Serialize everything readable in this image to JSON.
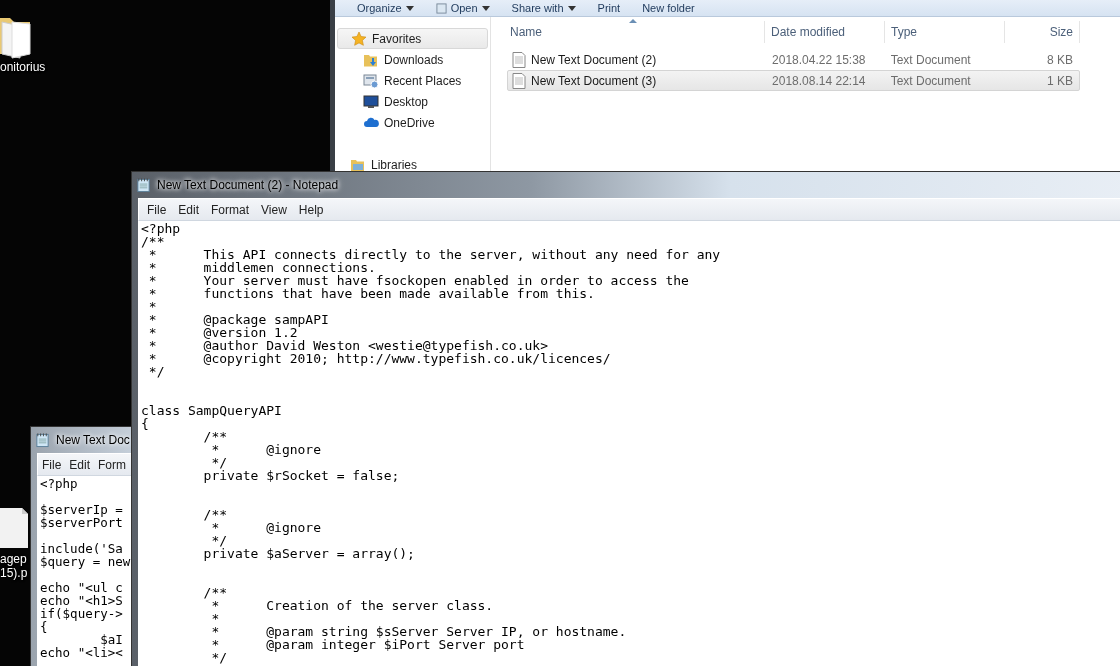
{
  "desktop_icons": [
    {
      "kind": "folder",
      "label_lines": [
        "onitorius"
      ]
    },
    {
      "kind": "file",
      "label_lines": [
        "agep",
        "15).p"
      ]
    }
  ],
  "explorer": {
    "toolbar": [
      {
        "label": "Organize",
        "dropdown": true,
        "kind": "plain"
      },
      {
        "label": "Open",
        "dropdown": true,
        "kind": "document"
      },
      {
        "label": "Share with",
        "dropdown": true,
        "kind": "plain"
      },
      {
        "label": "Print",
        "dropdown": false,
        "kind": "plain"
      },
      {
        "label": "New folder",
        "dropdown": false,
        "kind": "plain"
      }
    ],
    "nav": [
      {
        "label": "Favorites",
        "kind": "star",
        "selected": true,
        "children": [
          {
            "label": "Downloads",
            "kind": "downloads",
            "selected": false
          },
          {
            "label": "Recent Places",
            "kind": "recent",
            "selected": false
          },
          {
            "label": "Desktop",
            "kind": "desktop",
            "selected": false
          },
          {
            "label": "OneDrive",
            "kind": "cloud",
            "selected": false
          }
        ]
      },
      {
        "label": "Libraries",
        "kind": "library",
        "selected": false
      }
    ],
    "columns": [
      "Name",
      "Date modified",
      "Type",
      "Size"
    ],
    "rows": [
      {
        "name": "New Text Document (2)",
        "date": "2018.04.22 15:38",
        "type": "Text Document",
        "size": "8 KB",
        "selected": false
      },
      {
        "name": "New Text Document (3)",
        "date": "2018.08.14 22:14",
        "type": "Text Document",
        "size": "1 KB",
        "selected": true
      }
    ]
  },
  "notepad_background": {
    "title": "New Text Doc",
    "menu": [
      "File",
      "Edit",
      "Form"
    ],
    "content": "<?php\n\n$serverIp =\n$serverPort\n\ninclude('Sa\n$query = new\n\necho \"<ul c\necho \"<h1>S\nif($query->\n{\n        $aI\necho \"<li><"
  },
  "notepad_main": {
    "title": "New Text Document (2) - Notepad",
    "menu": [
      "File",
      "Edit",
      "Format",
      "View",
      "Help"
    ],
    "content": "<?php\n/**\n *      This API connects directly to the server, without any need for any\n *      middlemen connections.\n *      Your server must have fsockopen enabled in order to access the\n *      functions that have been made available from this.\n *\n *      @package sampAPI\n *      @version 1.2\n *      @author David Weston <westie@typefish.co.uk>\n *      @copyright 2010; http://www.typefish.co.uk/licences/\n */\n\n\nclass SampQueryAPI\n{\n        /**\n         *      @ignore\n         */\n        private $rSocket = false;\n\n\n        /**\n         *      @ignore\n         */\n        private $aServer = array();\n\n\n        /**\n         *      Creation of the server class.\n         *\n         *      @param string $sServer Server IP, or hostname.\n         *      @param integer $iPort Server port\n         */"
  }
}
